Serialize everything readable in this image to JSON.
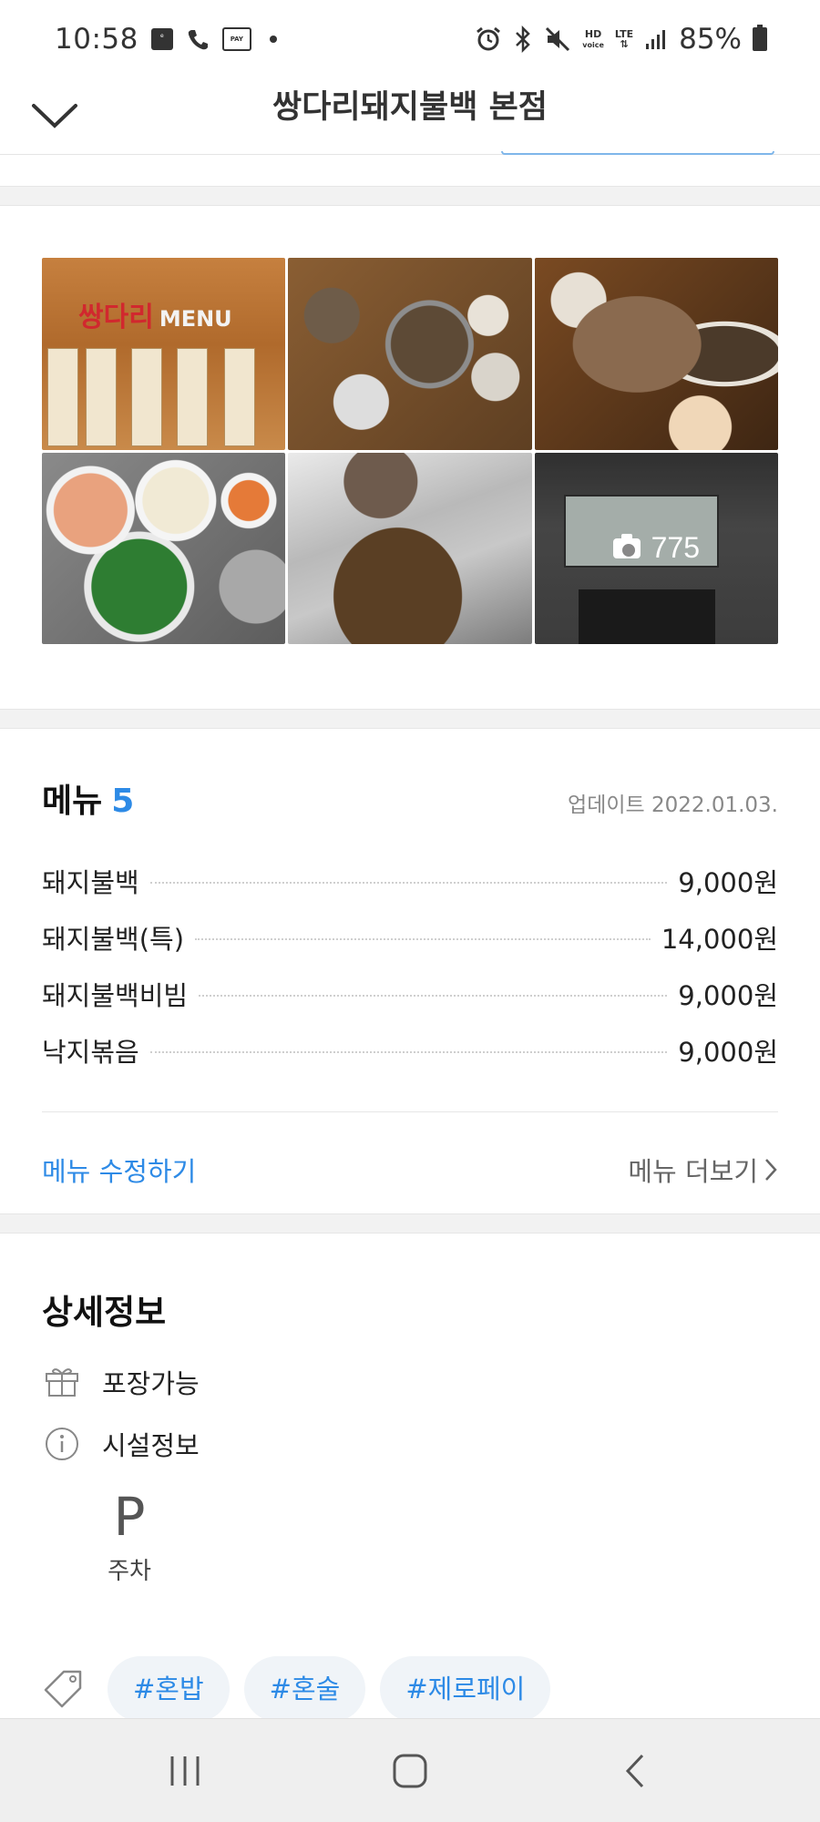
{
  "status_bar": {
    "time": "10:58",
    "left_icons": [
      "emart-everyday-icon",
      "call-icon",
      "payco-icon",
      "dot"
    ],
    "right_icons": [
      "alarm-icon",
      "bluetooth-icon",
      "mute-icon",
      "hd-voice-icon",
      "lte-icon",
      "signal-icon"
    ],
    "hd_label": "HD",
    "voice_label": "voice",
    "lte_label": "LTE",
    "battery": "85%"
  },
  "header": {
    "title": "쌍다리돼지불백 본점"
  },
  "photos": {
    "sign_text": "쌍다리",
    "sign_menu": "MENU",
    "more_count": "775"
  },
  "menu": {
    "title": "메뉴",
    "count": "5",
    "updated": "업데이트 2022.01.03.",
    "items": [
      {
        "name": "돼지불백",
        "price": "9,000원"
      },
      {
        "name": "돼지불백(특)",
        "price": "14,000원"
      },
      {
        "name": "돼지불백비빔",
        "price": "9,000원"
      },
      {
        "name": "낙지볶음",
        "price": "9,000원"
      }
    ],
    "edit_label": "메뉴 수정하기",
    "more_label": "메뉴 더보기"
  },
  "detail": {
    "title": "상세정보",
    "takeout": "포장가능",
    "facilities": "시설정보",
    "parking_glyph": "P",
    "parking": "주차"
  },
  "tags": [
    "#혼밥",
    "#혼술",
    "#제로페이"
  ],
  "colors": {
    "accent": "#2d8ae6",
    "text": "#222222",
    "band": "#f2f2f2",
    "nav": "#efefef"
  }
}
